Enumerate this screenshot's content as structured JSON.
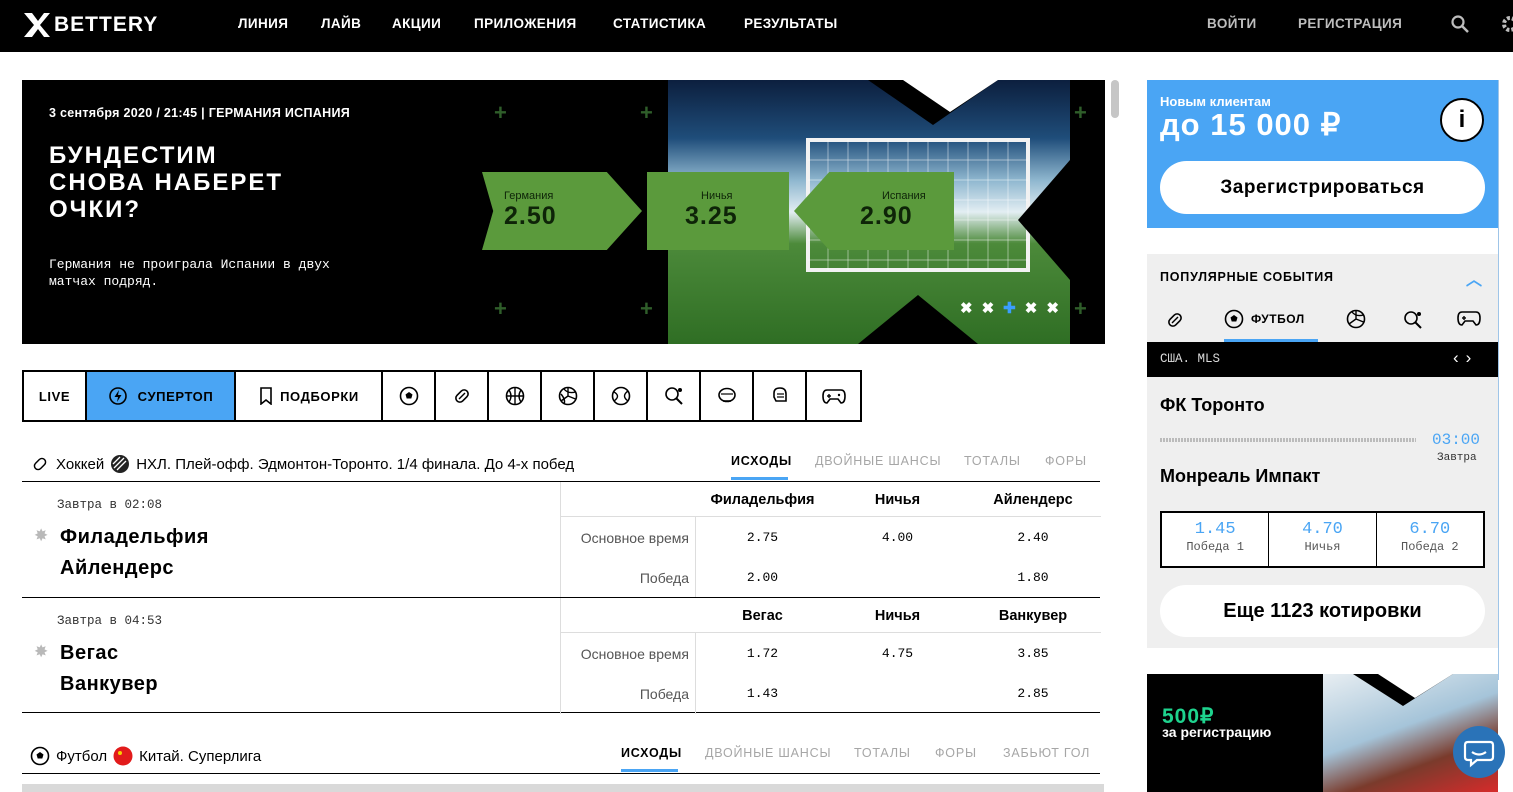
{
  "header": {
    "logo": "BETTERY",
    "nav": [
      "ЛИНИЯ",
      "ЛАЙВ",
      "АКЦИИ",
      "ПРИЛОЖЕНИЯ",
      "СТАТИСТИКА",
      "РЕЗУЛЬТАТЫ"
    ],
    "login": "ВОЙТИ",
    "register": "РЕГИСТРАЦИЯ",
    "icons": [
      "search-icon",
      "gear-icon"
    ]
  },
  "banner": {
    "meta": "3 сентября 2020 / 21:45 | ГЕРМАНИЯ ИСПАНИЯ",
    "title_line1": "БУНДЕСТИМ",
    "title_line2": "СНОВА НАБЕРЕТ",
    "title_line3": "ОЧКИ?",
    "description": "Германия не проиграла Испании в двух матчах подряд.",
    "odds": [
      {
        "label": "Германия",
        "value": "2.50"
      },
      {
        "label": "Ничья",
        "value": "3.25"
      },
      {
        "label": "Испания",
        "value": "2.90"
      }
    ]
  },
  "sport_tabs": {
    "live": "LIVE",
    "supertop": "СУПЕРТОП",
    "collections": "ПОДБОРКИ",
    "icons": [
      "football-icon",
      "hockey-icon",
      "basketball-icon",
      "volleyball-icon",
      "tennis-icon",
      "table-tennis-icon",
      "boxing-icon",
      "mma-icon",
      "esports-icon"
    ]
  },
  "section1": {
    "sport": "Хоккей",
    "league": "НХЛ. Плей-офф. Эдмонтон-Торонто. 1/4 финала. До 4-х побед",
    "market_tabs": [
      "ИСХОДЫ",
      "ДВОЙНЫЕ ШАНСЫ",
      "ТОТАЛЫ",
      "ФОРЫ"
    ],
    "matches": [
      {
        "time": "Завтра в 02:08",
        "home": "Филадельфия",
        "away": "Айлендерс",
        "col_home": "Филадельфия",
        "col_draw": "Ничья",
        "col_away": "Айлендерс",
        "row1_label": "Основное время",
        "row1": [
          "2.75",
          "4.00",
          "2.40"
        ],
        "row2_label": "Победа",
        "row2": [
          "2.00",
          "",
          "1.80"
        ]
      },
      {
        "time": "Завтра в 04:53",
        "home": "Вегас",
        "away": "Ванкувер",
        "col_home": "Вегас",
        "col_draw": "Ничья",
        "col_away": "Ванкувер",
        "row1_label": "Основное время",
        "row1": [
          "1.72",
          "4.75",
          "3.85"
        ],
        "row2_label": "Победа",
        "row2": [
          "1.43",
          "",
          "2.85"
        ]
      }
    ]
  },
  "section2": {
    "sport": "Футбол",
    "league": "Китай. Суперлига",
    "market_tabs": [
      "ИСХОДЫ",
      "ДВОЙНЫЕ ШАНСЫ",
      "ТОТАЛЫ",
      "ФОРЫ",
      "ЗАБЬЮТ ГОЛ"
    ]
  },
  "promo": {
    "subtitle": "Новым клиентам",
    "amount": "до 15 000 ₽",
    "info": "i",
    "button": "Зарегистрироваться"
  },
  "popular": {
    "title": "ПОПУЛЯРНЫЕ СОБЫТИЯ",
    "active_sport": "ФУТБОЛ",
    "league": "США. MLS",
    "home": "ФК Торонто",
    "away": "Монреаль Импакт",
    "clock": "03:00",
    "clock_note": "Завтра",
    "odds": [
      {
        "value": "1.45",
        "label": "Победа 1"
      },
      {
        "value": "4.70",
        "label": "Ничья"
      },
      {
        "value": "6.70",
        "label": "Победа 2"
      }
    ],
    "more": "Еще 1123 котировки"
  },
  "ad": {
    "amount": "500₽",
    "text": "за регистрацию"
  },
  "colors": {
    "accent": "#4aa5f4",
    "odds_green": "#5b9a3c",
    "header_bg": "#000000"
  }
}
